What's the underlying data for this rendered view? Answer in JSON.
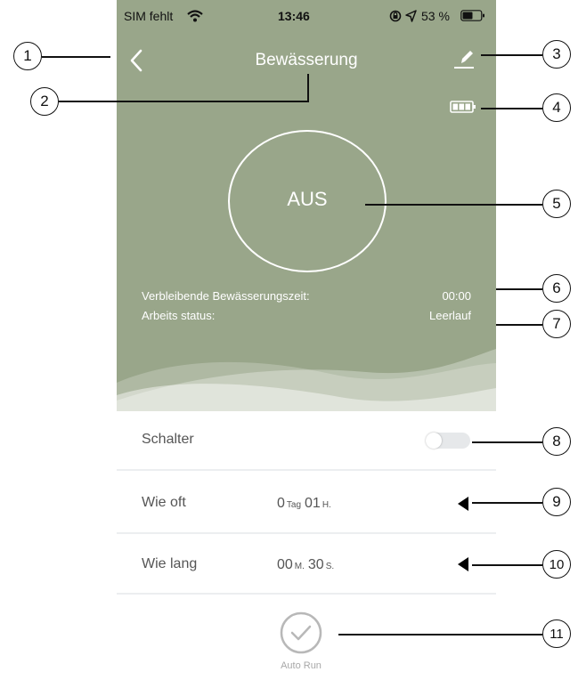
{
  "status_bar": {
    "carrier": "SIM fehlt",
    "time": "13:46",
    "battery_percent": "53 %"
  },
  "header": {
    "title": "Bewässerung"
  },
  "dial": {
    "state": "AUS"
  },
  "info": {
    "remaining_label": "Verbleibende Bewässerungszeit:",
    "remaining_value": "00:00",
    "status_label": "Arbeits status:",
    "status_value": "Leerlauf"
  },
  "settings": {
    "switch_label": "Schalter",
    "switch_on": false,
    "frequency": {
      "label": "Wie oft",
      "days": "0",
      "days_unit": "Tag",
      "hours": "01",
      "hours_unit": "H."
    },
    "duration": {
      "label": "Wie lang",
      "minutes": "00",
      "minutes_unit": "M.",
      "seconds": "30",
      "seconds_unit": "S."
    }
  },
  "auto_run": {
    "label": "Auto Run"
  },
  "callouts": [
    "1",
    "2",
    "3",
    "4",
    "5",
    "6",
    "7",
    "8",
    "9",
    "10",
    "11"
  ],
  "colors": {
    "hero": "#99a68a",
    "white": "#ffffff",
    "row_divider": "#eceef0",
    "toggle": "#e6e8ea"
  },
  "icons": [
    "back-chevron-icon",
    "wifi-icon",
    "lock-rotation-icon",
    "location-arrow-icon",
    "battery-icon",
    "edit-pencil-icon",
    "device-battery-icon",
    "collapse-arrow-icon",
    "check-circle-icon"
  ]
}
